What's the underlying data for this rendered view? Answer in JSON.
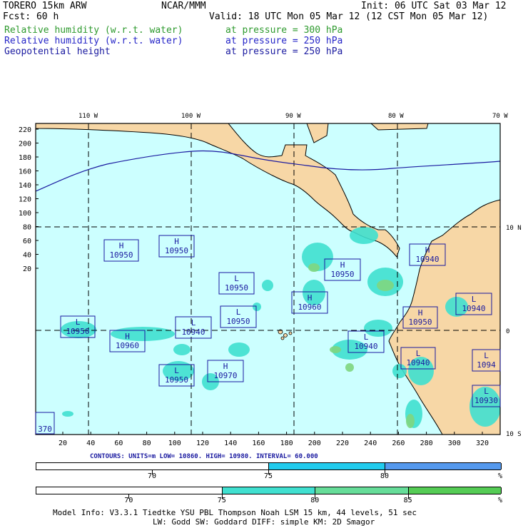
{
  "header": {
    "model": "TORERO  15km ARW",
    "org": "NCAR/MMM",
    "init": "Init: 06 UTC Sat 03 Mar 12",
    "fcst": "Fcst:   60 h",
    "valid": "Valid: 18 UTC Mon 05 Mar 12 (12 CST Mon 05 Mar 12)"
  },
  "fields": [
    {
      "name": "Relative humidity (w.r.t. water)",
      "level": "at pressure =  300 hPa",
      "color": "#2e9a2e"
    },
    {
      "name": "Relative humidity (w.r.t. water)",
      "level": "at pressure =  250 hPa",
      "color": "#2626c8"
    },
    {
      "name": "Geopotential height",
      "level": "at pressure =  250 hPa",
      "color": "#1a1aa0"
    }
  ],
  "map": {
    "top_lon_labels": [
      "110 W",
      "100 W",
      "90 W",
      "80 W",
      "70 W"
    ],
    "right_lat_labels": [
      "10 N",
      "0",
      "10 S"
    ],
    "y_ticks": [
      "220",
      "200",
      "180",
      "160",
      "140",
      "120",
      "100",
      "80",
      "60",
      "40",
      "20"
    ],
    "x_ticks": [
      "20",
      "40",
      "60",
      "80",
      "100",
      "120",
      "140",
      "160",
      "180",
      "200",
      "220",
      "240",
      "260",
      "280",
      "300",
      "320"
    ],
    "colors": {
      "ocean": "#ccffff",
      "land": "#f7d7a6",
      "rh_cyan": "#40e0d0",
      "rh_green": "#7fd67f",
      "box": "#1a1aa0"
    },
    "pressure_centers": [
      {
        "type": "H",
        "value": "10950"
      },
      {
        "type": "H",
        "value": "10950"
      },
      {
        "type": "L",
        "value": "10950"
      },
      {
        "type": "H",
        "value": "10950"
      },
      {
        "type": "H",
        "value": "10940"
      },
      {
        "type": "L",
        "value": "10950"
      },
      {
        "type": "L",
        "value": "10940"
      },
      {
        "type": "L",
        "value": "10950"
      },
      {
        "type": "H",
        "value": "10960"
      },
      {
        "type": "H",
        "value": "10960"
      },
      {
        "type": "H",
        "value": "10950"
      },
      {
        "type": "L",
        "value": "10940"
      },
      {
        "type": "L",
        "value": "10940"
      },
      {
        "type": "L",
        "value": "10940"
      },
      {
        "type": "L",
        "value": "10950"
      },
      {
        "type": "H",
        "value": "10970"
      },
      {
        "type": "L",
        "value": "1094"
      },
      {
        "type": "L",
        "value": "10930"
      },
      {
        "type": "",
        "value": "370"
      }
    ]
  },
  "contours_label": "CONTOURS:  UNITS=m  LOW=  10860.      HIGH=  10980.      INTERVAL=   60.000",
  "colorbar1": {
    "ticks": [
      "70",
      "75",
      "80"
    ],
    "unit": "%",
    "segments": [
      {
        "value_from": 65,
        "value_to": 75,
        "color": "#ffffff"
      },
      {
        "value_from": 75,
        "value_to": 80,
        "color": "#22ccee"
      },
      {
        "value_from": 80,
        "value_to": 85,
        "color": "#5599ee"
      }
    ]
  },
  "colorbar2": {
    "ticks": [
      "70",
      "75",
      "80",
      "85"
    ],
    "unit": "%",
    "segments": [
      {
        "value_from": 65,
        "value_to": 75,
        "color": "#ffffff"
      },
      {
        "value_from": 75,
        "value_to": 80,
        "color": "#40e0d0"
      },
      {
        "value_from": 80,
        "value_to": 85,
        "color": "#66dd99"
      },
      {
        "value_from": 85,
        "value_to": 90,
        "color": "#55cc55"
      }
    ]
  },
  "footer": {
    "line1": "Model Info: V3.3.1   Tiedtke YSU PBL  Thompson    Noah LSM  15 km,   44 levels,   51 sec",
    "line2": "LW: Godd SW: Goddard DIFF: simple KM: 2D Smagor"
  }
}
